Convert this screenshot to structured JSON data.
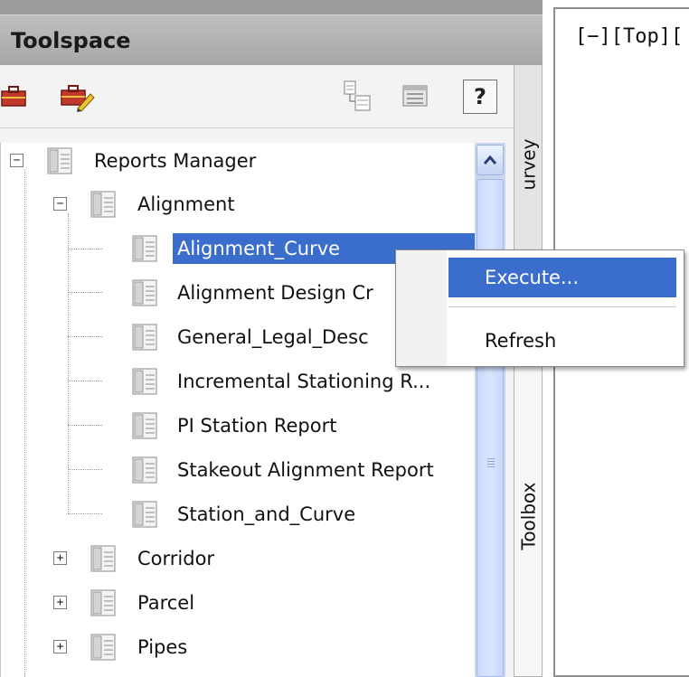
{
  "palette": {
    "title": "Toolspace",
    "toolbar": {
      "left_buttons": [
        "toolbox-icon",
        "edit-toolbox-icon"
      ],
      "right_buttons": [
        "report-settings-icon",
        "display-panel-icon",
        "help-icon"
      ],
      "help_label": "?"
    },
    "tree": {
      "root": {
        "label": "Reports Manager",
        "expander": "−"
      },
      "alignment": {
        "label": "Alignment",
        "expander": "−"
      },
      "alignment_reports": [
        "Alignment_Curve",
        "Alignment Design Cr",
        "General_Legal_Desc",
        "Incremental Stationing R...",
        "PI Station Report",
        "Stakeout Alignment Report",
        "Station_and_Curve"
      ],
      "selected_report": "Alignment_Curve",
      "collapsed_groups": [
        {
          "label": "Corridor",
          "expander": "+"
        },
        {
          "label": "Parcel",
          "expander": "+"
        },
        {
          "label": "Pipes",
          "expander": "+"
        }
      ]
    },
    "tabs": {
      "survey": "urvey",
      "toolbox": "Toolbox"
    }
  },
  "viewport": {
    "label": "[−][Top]["
  },
  "context_menu": {
    "items": [
      "Execute...",
      "Refresh"
    ],
    "highlighted": "Execute..."
  },
  "colors": {
    "selection": "#3b6dcd",
    "title_bar": "#b4b4b4",
    "scrollbar": "#c9d6f2"
  }
}
